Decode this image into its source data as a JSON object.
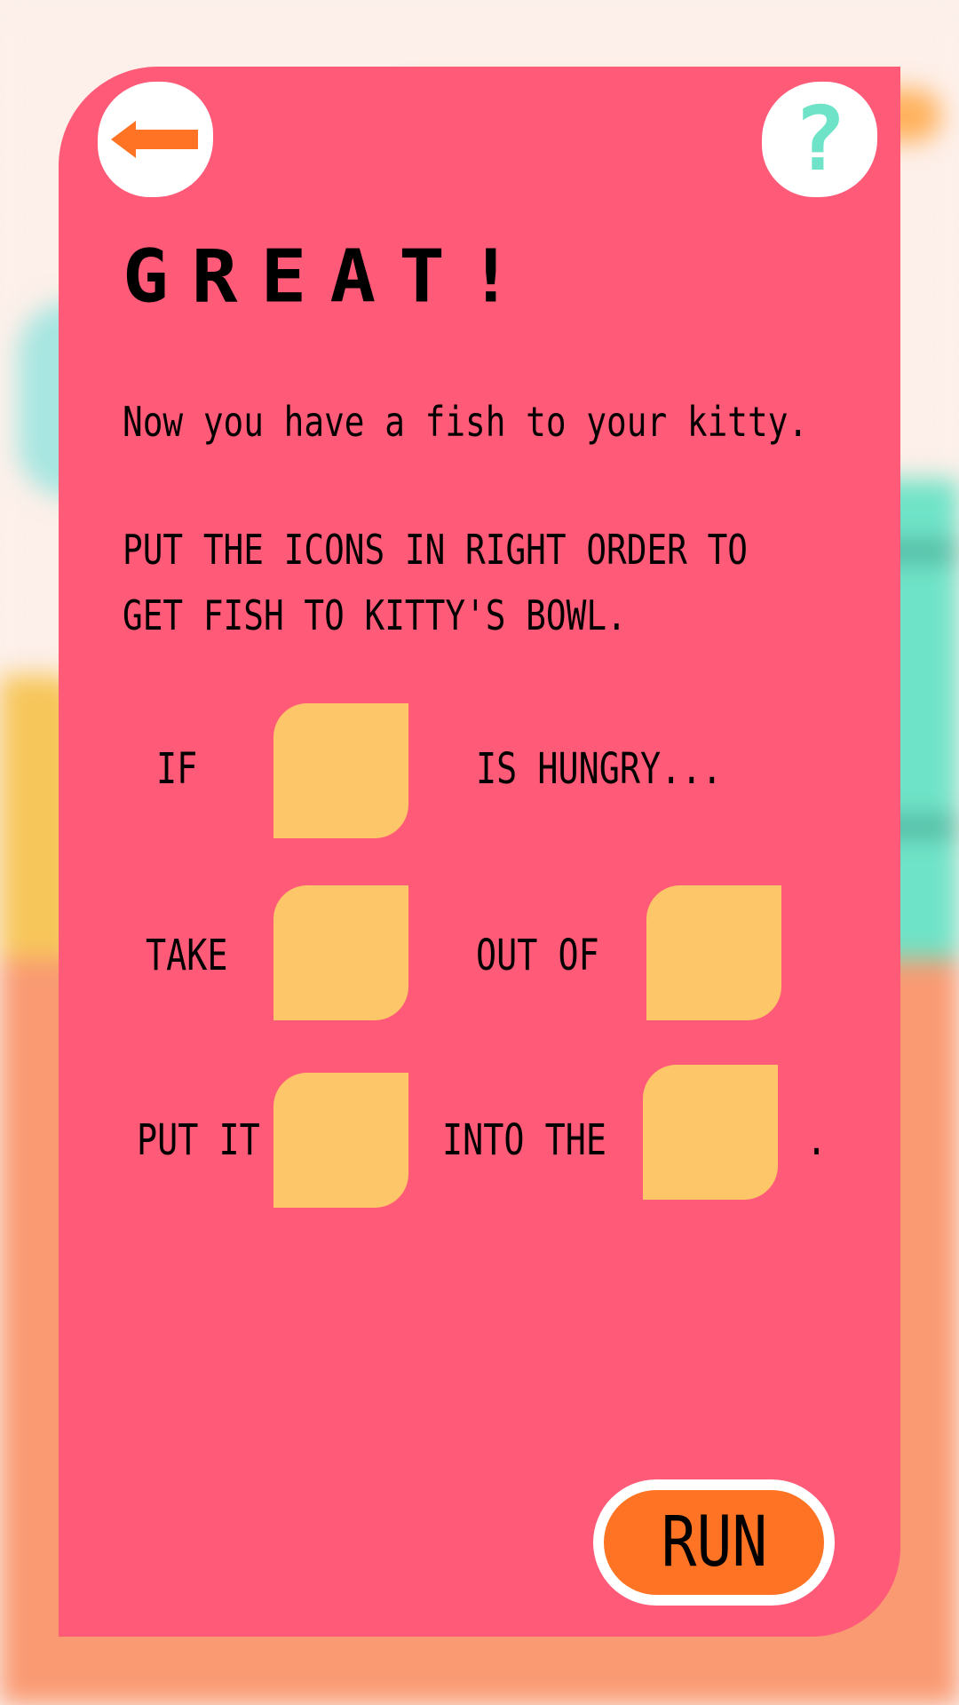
{
  "header": {
    "back_icon": "arrow-left-icon",
    "help_label": "?"
  },
  "title": "GREAT!",
  "intro": "Now you have a fish to your kitty.",
  "instructions": {
    "line1": "PUT THE ICONS IN RIGHT ORDER TO",
    "line2": "GET FISH TO KITTY'S BOWL."
  },
  "puzzle": {
    "row1": {
      "word_if": "IF",
      "word_hungry": "IS HUNGRY..."
    },
    "row2": {
      "word_take": "TAKE",
      "word_outof": "OUT OF"
    },
    "row3": {
      "word_putit": "PUT IT",
      "word_intothe": "INTO THE",
      "end": "."
    }
  },
  "run_label": "RUN",
  "colors": {
    "panel": "#ff5a78",
    "slot": "#fdc668",
    "run": "#ff7424",
    "accent_teal": "#6fe3c7",
    "arrow": "#ff7424"
  }
}
